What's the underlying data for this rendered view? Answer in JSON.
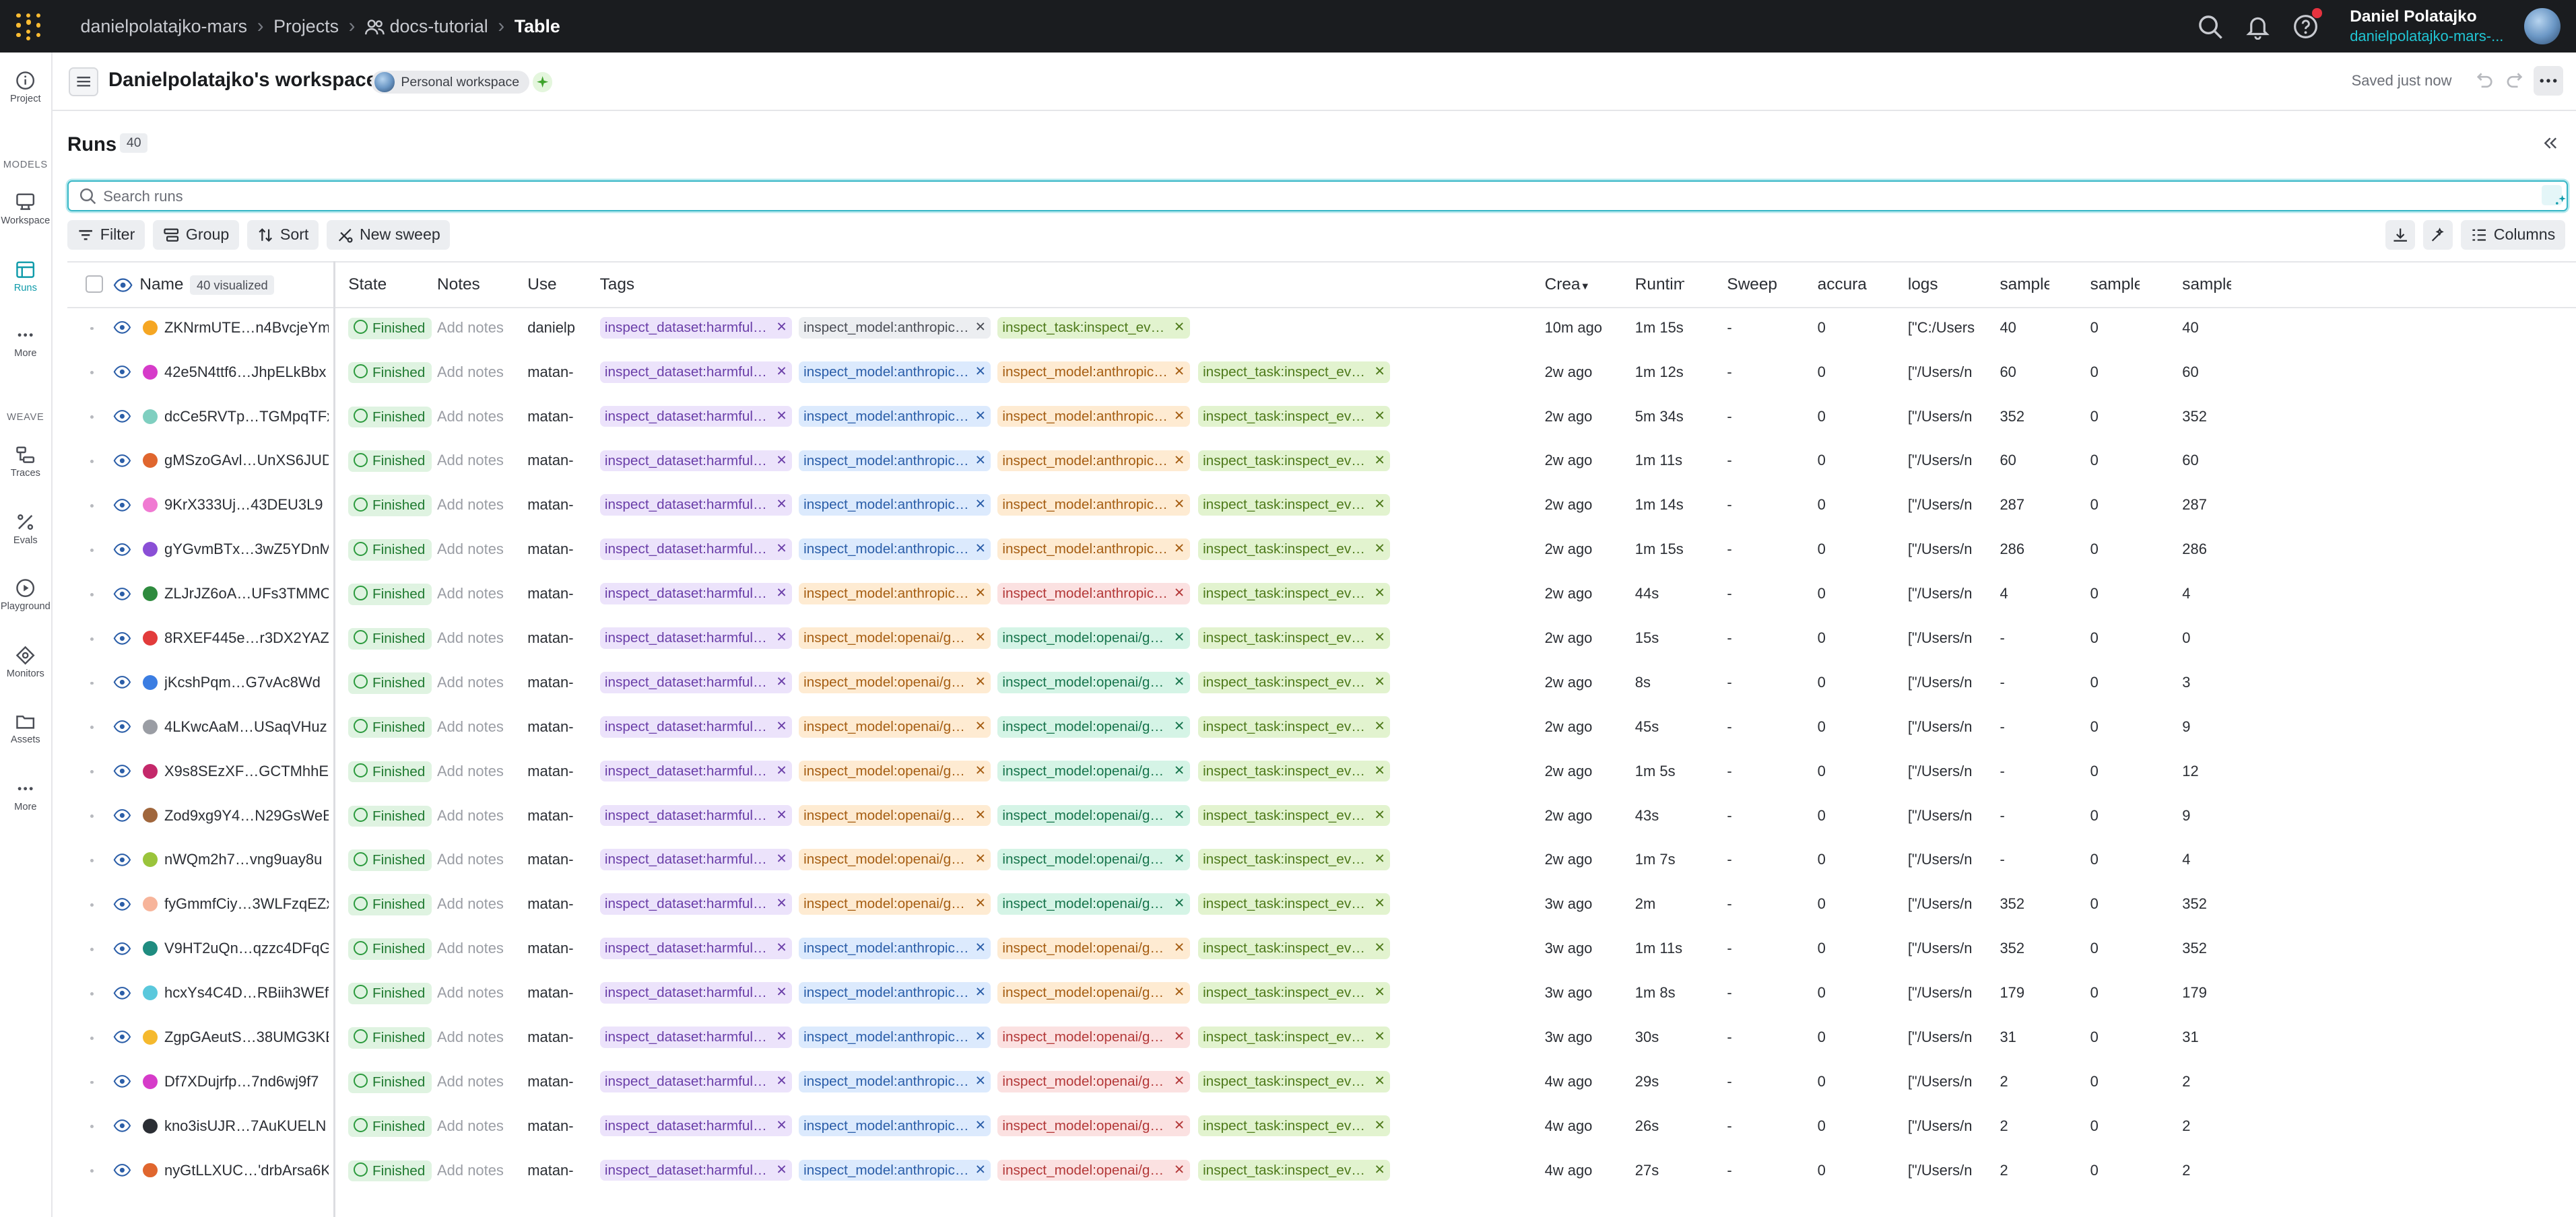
{
  "breadcrumb": {
    "entity": "danielpolatajko-mars",
    "projects": "Projects",
    "project": "docs-tutorial",
    "page": "Table"
  },
  "user": {
    "name": "Daniel Polatajko",
    "org": "danielpolatajko-mars-..."
  },
  "nav": {
    "project": "Project",
    "models_heading": "MODELS",
    "workspace": "Workspace",
    "runs": "Runs",
    "more1": "More",
    "weave_heading": "WEAVE",
    "traces": "Traces",
    "evals": "Evals",
    "playground": "Playground",
    "monitors": "Monitors",
    "assets": "Assets",
    "more2": "More"
  },
  "workspace": {
    "title": "Danielpolatajko's workspace",
    "badge": "Personal workspace",
    "saved": "Saved just now"
  },
  "runs": {
    "title": "Runs",
    "count": "40",
    "search_placeholder": "Search runs"
  },
  "toolbar": {
    "filter": "Filter",
    "group": "Group",
    "sort": "Sort",
    "new_sweep": "New sweep",
    "columns": "Columns"
  },
  "columns": {
    "name": "Name",
    "visualized": "40 visualized",
    "state": "State",
    "notes": "Notes",
    "user": "Use",
    "tags": "Tags",
    "created": "Crea",
    "runtime": "Runtim",
    "sweep": "Sweep",
    "accuracy": "accura",
    "logs": "logs",
    "s1": "sample",
    "s2": "sample",
    "s3": "sample"
  },
  "colors": {
    "accent": "#0f9baa",
    "topbar": "#1a1c1f"
  },
  "rows": [
    {
      "name": "ZKNrmUTE…n4BvcjeYm",
      "color": "#f5a623",
      "state": "Finished",
      "notes": "Add notes",
      "user": "danielp",
      "tags": [
        [
          "inspect_dataset:harmful_…",
          "purple"
        ],
        [
          "inspect_model:anthropic/…",
          "grey"
        ],
        [
          "inspect_task:inspect_eva…",
          "green"
        ]
      ],
      "created": "10m ago",
      "runtime": "1m 15s",
      "sweep": "-",
      "acc": "0",
      "logs": "[\"C:/Users",
      "s1": "40",
      "s2": "0",
      "s3": "40"
    },
    {
      "name": "42e5N4ttf6…JhpELkBbx",
      "color": "#d63bc9",
      "state": "Finished",
      "notes": "Add notes",
      "user": "matan-",
      "tags": [
        [
          "inspect_dataset:harmful_…",
          "purple"
        ],
        [
          "inspect_model:anthropic/…",
          "blue"
        ],
        [
          "inspect_model:anthropic/…",
          "orange"
        ],
        [
          "inspect_task:inspect_eva…",
          "green"
        ]
      ],
      "created": "2w ago",
      "runtime": "1m 12s",
      "sweep": "-",
      "acc": "0",
      "logs": "[\"/Users/n",
      "s1": "60",
      "s2": "0",
      "s3": "60"
    },
    {
      "name": "dcCe5RVTp…TGMpqTFx",
      "color": "#7fcfc0",
      "state": "Finished",
      "notes": "Add notes",
      "user": "matan-",
      "tags": [
        [
          "inspect_dataset:harmful_…",
          "purple"
        ],
        [
          "inspect_model:anthropic/…",
          "blue"
        ],
        [
          "inspect_model:anthropic/…",
          "orange"
        ],
        [
          "inspect_task:inspect_eva…",
          "green"
        ]
      ],
      "created": "2w ago",
      "runtime": "5m 34s",
      "sweep": "-",
      "acc": "0",
      "logs": "[\"/Users/n",
      "s1": "352",
      "s2": "0",
      "s3": "352"
    },
    {
      "name": "gMSzoGAvl…UnXS6JUD",
      "color": "#e0662e",
      "state": "Finished",
      "notes": "Add notes",
      "user": "matan-",
      "tags": [
        [
          "inspect_dataset:harmful_…",
          "purple"
        ],
        [
          "inspect_model:anthropic/…",
          "blue"
        ],
        [
          "inspect_model:anthropic/…",
          "orange"
        ],
        [
          "inspect_task:inspect_eva…",
          "green"
        ]
      ],
      "created": "2w ago",
      "runtime": "1m 11s",
      "sweep": "-",
      "acc": "0",
      "logs": "[\"/Users/n",
      "s1": "60",
      "s2": "0",
      "s3": "60"
    },
    {
      "name": "9KrX333Uj…43DEU3L9",
      "color": "#f07ad2",
      "state": "Finished",
      "notes": "Add notes",
      "user": "matan-",
      "tags": [
        [
          "inspect_dataset:harmful_…",
          "purple"
        ],
        [
          "inspect_model:anthropic/…",
          "blue"
        ],
        [
          "inspect_model:anthropic/…",
          "orange"
        ],
        [
          "inspect_task:inspect_eva…",
          "green"
        ]
      ],
      "created": "2w ago",
      "runtime": "1m 14s",
      "sweep": "-",
      "acc": "0",
      "logs": "[\"/Users/n",
      "s1": "287",
      "s2": "0",
      "s3": "287"
    },
    {
      "name": "gYGvmBTx…3wZ5YDnM",
      "color": "#8a4fd6",
      "state": "Finished",
      "notes": "Add notes",
      "user": "matan-",
      "tags": [
        [
          "inspect_dataset:harmful_…",
          "purple"
        ],
        [
          "inspect_model:anthropic/…",
          "blue"
        ],
        [
          "inspect_model:anthropic/…",
          "orange"
        ],
        [
          "inspect_task:inspect_eva…",
          "green"
        ]
      ],
      "created": "2w ago",
      "runtime": "1m 15s",
      "sweep": "-",
      "acc": "0",
      "logs": "[\"/Users/n",
      "s1": "286",
      "s2": "0",
      "s3": "286"
    },
    {
      "name": "ZLJrJZ6oA…UFs3TMMC",
      "color": "#2e8b3e",
      "state": "Finished",
      "notes": "Add notes",
      "user": "matan-",
      "tags": [
        [
          "inspect_dataset:harmful_…",
          "purple"
        ],
        [
          "inspect_model:anthropic/…",
          "orange"
        ],
        [
          "inspect_model:anthropic/…",
          "red"
        ],
        [
          "inspect_task:inspect_eva…",
          "green"
        ]
      ],
      "created": "2w ago",
      "runtime": "44s",
      "sweep": "-",
      "acc": "0",
      "logs": "[\"/Users/n",
      "s1": "4",
      "s2": "0",
      "s3": "4"
    },
    {
      "name": "8RXEF445e…r3DX2YAZY",
      "color": "#e23b3b",
      "state": "Finished",
      "notes": "Add notes",
      "user": "matan-",
      "tags": [
        [
          "inspect_dataset:harmful_…",
          "purple"
        ],
        [
          "inspect_model:openai/gpt…",
          "orange"
        ],
        [
          "inspect_model:openai/gpt…",
          "teal"
        ],
        [
          "inspect_task:inspect_eva…",
          "green"
        ]
      ],
      "created": "2w ago",
      "runtime": "15s",
      "sweep": "-",
      "acc": "0",
      "logs": "[\"/Users/n",
      "s1": "-",
      "s2": "0",
      "s3": "0"
    },
    {
      "name": "jKcshPqm…G7vAc8Wd",
      "color": "#3b7de2",
      "state": "Finished",
      "notes": "Add notes",
      "user": "matan-",
      "tags": [
        [
          "inspect_dataset:harmful_…",
          "purple"
        ],
        [
          "inspect_model:openai/gpt…",
          "orange"
        ],
        [
          "inspect_model:openai/gpt…",
          "teal"
        ],
        [
          "inspect_task:inspect_eva…",
          "green"
        ]
      ],
      "created": "2w ago",
      "runtime": "8s",
      "sweep": "-",
      "acc": "0",
      "logs": "[\"/Users/n",
      "s1": "-",
      "s2": "0",
      "s3": "3"
    },
    {
      "name": "4LKwcAaM…USaqVHuz",
      "color": "#9a9da4",
      "state": "Finished",
      "notes": "Add notes",
      "user": "matan-",
      "tags": [
        [
          "inspect_dataset:harmful_…",
          "purple"
        ],
        [
          "inspect_model:openai/gpt…",
          "orange"
        ],
        [
          "inspect_model:openai/gpt…",
          "teal"
        ],
        [
          "inspect_task:inspect_eva…",
          "green"
        ]
      ],
      "created": "2w ago",
      "runtime": "45s",
      "sweep": "-",
      "acc": "0",
      "logs": "[\"/Users/n",
      "s1": "-",
      "s2": "0",
      "s3": "9"
    },
    {
      "name": "X9s8SEzXF…GCTMhhEZ",
      "color": "#c4286a",
      "state": "Finished",
      "notes": "Add notes",
      "user": "matan-",
      "tags": [
        [
          "inspect_dataset:harmful_…",
          "purple"
        ],
        [
          "inspect_model:openai/gpt…",
          "orange"
        ],
        [
          "inspect_model:openai/gpt…",
          "teal"
        ],
        [
          "inspect_task:inspect_eva…",
          "green"
        ]
      ],
      "created": "2w ago",
      "runtime": "1m 5s",
      "sweep": "-",
      "acc": "0",
      "logs": "[\"/Users/n",
      "s1": "-",
      "s2": "0",
      "s3": "12"
    },
    {
      "name": "Zod9xg9Y4…N29GsWeB",
      "color": "#a0663c",
      "state": "Finished",
      "notes": "Add notes",
      "user": "matan-",
      "tags": [
        [
          "inspect_dataset:harmful_…",
          "purple"
        ],
        [
          "inspect_model:openai/gpt…",
          "orange"
        ],
        [
          "inspect_model:openai/gpt…",
          "teal"
        ],
        [
          "inspect_task:inspect_eva…",
          "green"
        ]
      ],
      "created": "2w ago",
      "runtime": "43s",
      "sweep": "-",
      "acc": "0",
      "logs": "[\"/Users/n",
      "s1": "-",
      "s2": "0",
      "s3": "9"
    },
    {
      "name": "nWQm2h7…vng9uay8u",
      "color": "#9ac43b",
      "state": "Finished",
      "notes": "Add notes",
      "user": "matan-",
      "tags": [
        [
          "inspect_dataset:harmful_…",
          "purple"
        ],
        [
          "inspect_model:openai/gpt…",
          "orange"
        ],
        [
          "inspect_model:openai/gpt…",
          "teal"
        ],
        [
          "inspect_task:inspect_eva…",
          "green"
        ]
      ],
      "created": "2w ago",
      "runtime": "1m 7s",
      "sweep": "-",
      "acc": "0",
      "logs": "[\"/Users/n",
      "s1": "-",
      "s2": "0",
      "s3": "4"
    },
    {
      "name": "fyGmmfCiy…3WLFzqEZx",
      "color": "#f7b49a",
      "state": "Finished",
      "notes": "Add notes",
      "user": "matan-",
      "tags": [
        [
          "inspect_dataset:harmful_…",
          "purple"
        ],
        [
          "inspect_model:openai/gpt…",
          "orange"
        ],
        [
          "inspect_model:openai/gpt…",
          "teal"
        ],
        [
          "inspect_task:inspect_eva…",
          "green"
        ]
      ],
      "created": "3w ago",
      "runtime": "2m",
      "sweep": "-",
      "acc": "0",
      "logs": "[\"/Users/n",
      "s1": "352",
      "s2": "0",
      "s3": "352"
    },
    {
      "name": "V9HT2uQn…qzzc4DFqG",
      "color": "#1f8c80",
      "state": "Finished",
      "notes": "Add notes",
      "user": "matan-",
      "tags": [
        [
          "inspect_dataset:harmful_…",
          "purple"
        ],
        [
          "inspect_model:anthropic/…",
          "blue"
        ],
        [
          "inspect_model:openai/gpt…",
          "orange"
        ],
        [
          "inspect_task:inspect_eva…",
          "green"
        ]
      ],
      "created": "3w ago",
      "runtime": "1m 11s",
      "sweep": "-",
      "acc": "0",
      "logs": "[\"/Users/n",
      "s1": "352",
      "s2": "0",
      "s3": "352"
    },
    {
      "name": "hcxYs4C4D…RBiih3WEf",
      "color": "#5ac8dc",
      "state": "Finished",
      "notes": "Add notes",
      "user": "matan-",
      "tags": [
        [
          "inspect_dataset:harmful_…",
          "purple"
        ],
        [
          "inspect_model:anthropic/…",
          "blue"
        ],
        [
          "inspect_model:openai/gpt…",
          "orange"
        ],
        [
          "inspect_task:inspect_eva…",
          "green"
        ]
      ],
      "created": "3w ago",
      "runtime": "1m 8s",
      "sweep": "-",
      "acc": "0",
      "logs": "[\"/Users/n",
      "s1": "179",
      "s2": "0",
      "s3": "179"
    },
    {
      "name": "ZgpGAeutS…38UMG3KE",
      "color": "#f5b92e",
      "state": "Finished",
      "notes": "Add notes",
      "user": "matan-",
      "tags": [
        [
          "inspect_dataset:harmful_…",
          "purple"
        ],
        [
          "inspect_model:anthropic/…",
          "blue"
        ],
        [
          "inspect_model:openai/gpt…",
          "red"
        ],
        [
          "inspect_task:inspect_eva…",
          "green"
        ]
      ],
      "created": "3w ago",
      "runtime": "30s",
      "sweep": "-",
      "acc": "0",
      "logs": "[\"/Users/n",
      "s1": "31",
      "s2": "0",
      "s3": "31"
    },
    {
      "name": "Df7XDujrfp…7nd6wj9f7",
      "color": "#d63bc9",
      "state": "Finished",
      "notes": "Add notes",
      "user": "matan-",
      "tags": [
        [
          "inspect_dataset:harmful_…",
          "purple"
        ],
        [
          "inspect_model:anthropic/…",
          "blue"
        ],
        [
          "inspect_model:openai/gpt…",
          "red"
        ],
        [
          "inspect_task:inspect_eva…",
          "green"
        ]
      ],
      "created": "4w ago",
      "runtime": "29s",
      "sweep": "-",
      "acc": "0",
      "logs": "[\"/Users/n",
      "s1": "2",
      "s2": "0",
      "s3": "2"
    },
    {
      "name": "kno3isUJR…7AuKUELN",
      "color": "#2b2e34",
      "state": "Finished",
      "notes": "Add notes",
      "user": "matan-",
      "tags": [
        [
          "inspect_dataset:harmful_…",
          "purple"
        ],
        [
          "inspect_model:anthropic/…",
          "blue"
        ],
        [
          "inspect_model:openai/gpt…",
          "red"
        ],
        [
          "inspect_task:inspect_eva…",
          "green"
        ]
      ],
      "created": "4w ago",
      "runtime": "26s",
      "sweep": "-",
      "acc": "0",
      "logs": "[\"/Users/n",
      "s1": "2",
      "s2": "0",
      "s3": "2"
    },
    {
      "name": "nyGtLLXUC…'drbArsa6K",
      "color": "#e0662e",
      "state": "Finished",
      "notes": "Add notes",
      "user": "matan-",
      "tags": [
        [
          "inspect_dataset:harmful_…",
          "purple"
        ],
        [
          "inspect_model:anthropic/…",
          "blue"
        ],
        [
          "inspect_model:openai/gpt…",
          "red"
        ],
        [
          "inspect_task:inspect_eva…",
          "green"
        ]
      ],
      "created": "4w ago",
      "runtime": "27s",
      "sweep": "-",
      "acc": "0",
      "logs": "[\"/Users/n",
      "s1": "2",
      "s2": "0",
      "s3": "2"
    }
  ]
}
